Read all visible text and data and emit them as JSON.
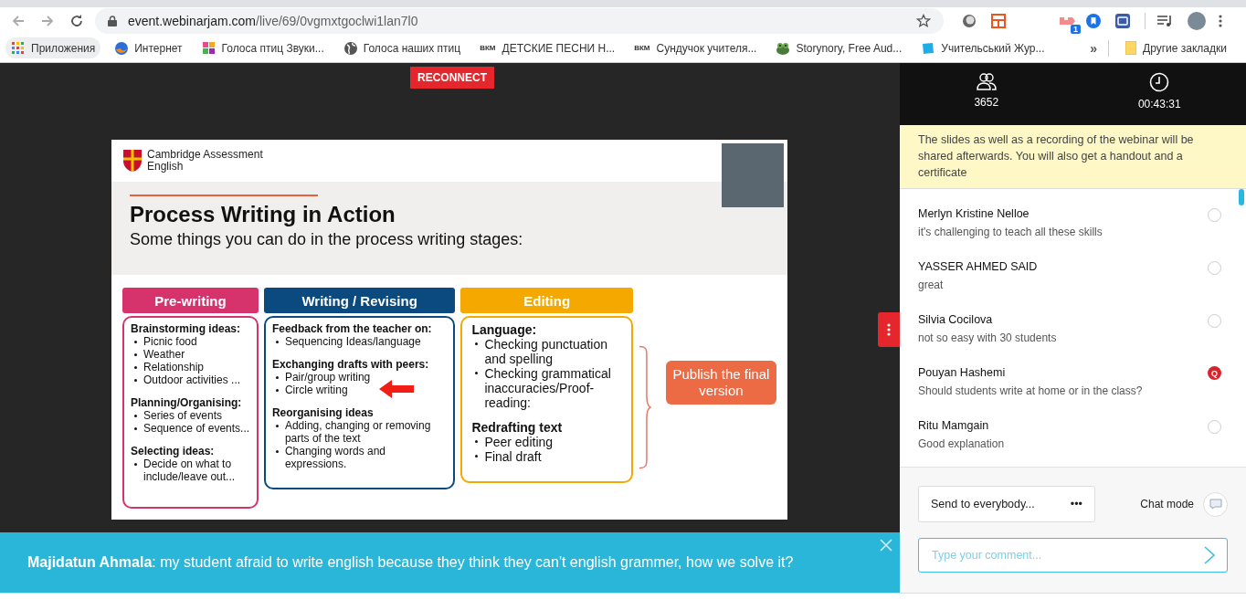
{
  "browser": {
    "url_host": "event.webinarjam.com",
    "url_path": "/live/69/0vgmxtgoclwi1lan7l0",
    "extension_badge": "1",
    "bookmarks": [
      {
        "label": "Приложения",
        "kind": "apps",
        "selected": true
      },
      {
        "label": "Интернет",
        "kind": "orb",
        "selected": false
      },
      {
        "label": "Голоса птиц Звуки...",
        "kind": "tiles",
        "selected": false
      },
      {
        "label": "Голоса наших птиц",
        "kind": "globe",
        "selected": false
      },
      {
        "label": "ДЕТСКИЕ ПЕСНИ Н...",
        "kind": "text",
        "icon_text": "ВКМ",
        "selected": false
      },
      {
        "label": "Сундучок учителя...",
        "kind": "text",
        "icon_text": "ВКМ",
        "selected": false
      },
      {
        "label": "Storynory, Free Aud...",
        "kind": "frog",
        "selected": false
      },
      {
        "label": "Учительський Жур...",
        "kind": "square",
        "selected": false
      }
    ],
    "more": "»",
    "other_bookmarks": "Другие закладки"
  },
  "stage": {
    "reconnect": "RECONNECT",
    "slide": {
      "brand": [
        "Cambridge Assessment",
        "English"
      ],
      "title": "Process Writing in Action",
      "subtitle": "Some things you can do in the process writing stages:",
      "columns": [
        {
          "heading": "Pre-writing",
          "color": "#d6336c",
          "sections": [
            {
              "heading": "Brainstorming ideas:",
              "bullets": [
                "Picnic food",
                "Weather",
                "Relationship",
                "Outdoor activities ..."
              ]
            },
            {
              "heading": "Planning/Organising:",
              "bullets": [
                "Series of events",
                "Sequence of events..."
              ]
            },
            {
              "heading": "Selecting ideas:",
              "bullets": [
                "Decide on what to include/leave out..."
              ]
            }
          ]
        },
        {
          "heading": "Writing / Revising",
          "color": "#0b4a7e",
          "sections": [
            {
              "heading": "Feedback from the teacher on:",
              "bullets": [
                "Sequencing Ideas/language"
              ]
            },
            {
              "heading": "Exchanging drafts with peers:",
              "bullets": [
                "Pair/group writing",
                "Circle writing"
              ],
              "pointer_arrow": true
            },
            {
              "heading": "Reorganising ideas",
              "bullets": [
                "Adding, changing or removing parts of the text",
                "Changing words and expressions."
              ]
            }
          ]
        },
        {
          "heading": "Editing",
          "color": "#f5a800",
          "sections": [
            {
              "heading": "Language:",
              "bullets": [
                "Checking punctuation and spelling",
                "Checking grammatical inaccuracies/Proof-reading:"
              ]
            },
            {
              "heading": "Redrafting text",
              "bullets": [
                "Peer editing",
                "Final draft"
              ]
            }
          ]
        }
      ],
      "outcome": "Publish the final version"
    },
    "banner": {
      "text": "**Majidatun Ahmala**: my student afraid to write english because they think they can't english grammer, how we solve it?"
    }
  },
  "panel": {
    "stats": [
      {
        "kind": "attendees",
        "value": "3652"
      },
      {
        "kind": "timer",
        "value": "00:43:31"
      }
    ],
    "notice": "The slides as well as a recording of the webinar will be shared afterwards. You will also get a handout and a certificate",
    "messages": [
      {
        "name": "Merlyn Kristine Nelloe",
        "text": "it's challenging to teach all these skills",
        "kind": "comment"
      },
      {
        "name": "YASSER AHMED SAID",
        "text": "great",
        "kind": "comment"
      },
      {
        "name": "Silvia Cocilova",
        "text": "not so easy with 30 students",
        "kind": "comment"
      },
      {
        "name": "Pouyan Hashemi",
        "text": "Should students write at home or in the class?",
        "kind": "question",
        "badge": "Q"
      },
      {
        "name": "Ritu Mamgain",
        "text": "Good explanation",
        "kind": "comment"
      }
    ],
    "composer": {
      "recipient": "Send to everybody...",
      "more": "•••",
      "chat_mode_label": "Chat mode",
      "placeholder": "Type your comment..."
    }
  }
}
